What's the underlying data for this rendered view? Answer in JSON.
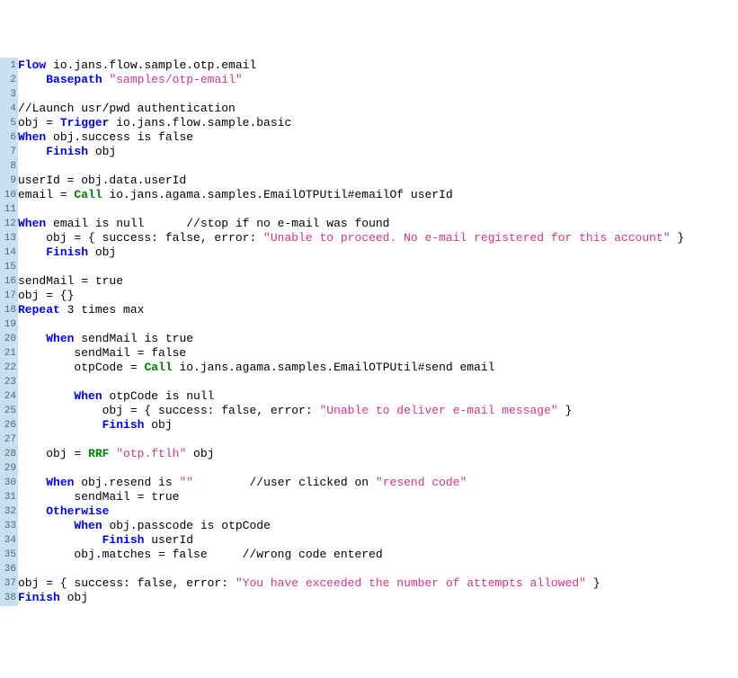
{
  "lines": [
    [
      [
        "kw-blue",
        "Flow"
      ],
      [
        "txt",
        " io.jans.flow.sample.otp.email"
      ]
    ],
    [
      [
        "txt",
        "    "
      ],
      [
        "kw-blue",
        "Basepath"
      ],
      [
        "txt",
        " "
      ],
      [
        "str",
        "\"samples/otp-email\""
      ]
    ],
    [
      [
        "txt",
        ""
      ]
    ],
    [
      [
        "txt",
        "//Launch usr/pwd authentication"
      ]
    ],
    [
      [
        "txt",
        "obj = "
      ],
      [
        "kw-blue",
        "Trigger"
      ],
      [
        "txt",
        " io.jans.flow.sample.basic"
      ]
    ],
    [
      [
        "kw-blue",
        "When"
      ],
      [
        "txt",
        " obj.success is false"
      ]
    ],
    [
      [
        "txt",
        "    "
      ],
      [
        "kw-blue",
        "Finish"
      ],
      [
        "txt",
        " obj"
      ]
    ],
    [
      [
        "txt",
        ""
      ]
    ],
    [
      [
        "txt",
        "userId = obj.data.userId"
      ]
    ],
    [
      [
        "txt",
        "email = "
      ],
      [
        "kw-green",
        "Call"
      ],
      [
        "txt",
        " io.jans.agama.samples.EmailOTPUtil#emailOf userId"
      ]
    ],
    [
      [
        "txt",
        ""
      ]
    ],
    [
      [
        "kw-blue",
        "When"
      ],
      [
        "txt",
        " email is null      //stop if no e-mail was found"
      ]
    ],
    [
      [
        "txt",
        "    obj = { success: false, error: "
      ],
      [
        "str",
        "\"Unable to proceed. No e-mail registered for this account\""
      ],
      [
        "txt",
        " }"
      ]
    ],
    [
      [
        "txt",
        "    "
      ],
      [
        "kw-blue",
        "Finish"
      ],
      [
        "txt",
        " obj"
      ]
    ],
    [
      [
        "txt",
        ""
      ]
    ],
    [
      [
        "txt",
        "sendMail = true"
      ]
    ],
    [
      [
        "txt",
        "obj = {}"
      ]
    ],
    [
      [
        "kw-blue",
        "Repeat"
      ],
      [
        "txt",
        " 3 times max"
      ]
    ],
    [
      [
        "txt",
        ""
      ]
    ],
    [
      [
        "txt",
        "    "
      ],
      [
        "kw-blue",
        "When"
      ],
      [
        "txt",
        " sendMail is true"
      ]
    ],
    [
      [
        "txt",
        "        sendMail = false"
      ]
    ],
    [
      [
        "txt",
        "        otpCode = "
      ],
      [
        "kw-green",
        "Call"
      ],
      [
        "txt",
        " io.jans.agama.samples.EmailOTPUtil#send email"
      ]
    ],
    [
      [
        "txt",
        ""
      ]
    ],
    [
      [
        "txt",
        "        "
      ],
      [
        "kw-blue",
        "When"
      ],
      [
        "txt",
        " otpCode is null"
      ]
    ],
    [
      [
        "txt",
        "            obj = { success: false, error: "
      ],
      [
        "str",
        "\"Unable to deliver e-mail message\""
      ],
      [
        "txt",
        " }"
      ]
    ],
    [
      [
        "txt",
        "            "
      ],
      [
        "kw-blue",
        "Finish"
      ],
      [
        "txt",
        " obj"
      ]
    ],
    [
      [
        "txt",
        ""
      ]
    ],
    [
      [
        "txt",
        "    obj = "
      ],
      [
        "kw-green",
        "RRF"
      ],
      [
        "txt",
        " "
      ],
      [
        "str",
        "\"otp.ftlh\""
      ],
      [
        "txt",
        " obj"
      ]
    ],
    [
      [
        "txt",
        ""
      ]
    ],
    [
      [
        "txt",
        "    "
      ],
      [
        "kw-blue",
        "When"
      ],
      [
        "txt",
        " obj.resend is "
      ],
      [
        "str",
        "\"\""
      ],
      [
        "txt",
        "        //user clicked on "
      ],
      [
        "str",
        "\"resend code\""
      ]
    ],
    [
      [
        "txt",
        "        sendMail = true"
      ]
    ],
    [
      [
        "txt",
        "    "
      ],
      [
        "kw-blue",
        "Otherwise"
      ]
    ],
    [
      [
        "txt",
        "        "
      ],
      [
        "kw-blue",
        "When"
      ],
      [
        "txt",
        " obj.passcode is otpCode"
      ]
    ],
    [
      [
        "txt",
        "            "
      ],
      [
        "kw-blue",
        "Finish"
      ],
      [
        "txt",
        " userId"
      ]
    ],
    [
      [
        "txt",
        "        obj.matches = false     //wrong code entered"
      ]
    ],
    [
      [
        "txt",
        ""
      ]
    ],
    [
      [
        "txt",
        "obj = { success: false, error: "
      ],
      [
        "str",
        "\"You have exceeded the number of attempts allowed\""
      ],
      [
        "txt",
        " }"
      ]
    ],
    [
      [
        "kw-blue",
        "Finish"
      ],
      [
        "txt",
        " obj"
      ]
    ]
  ]
}
